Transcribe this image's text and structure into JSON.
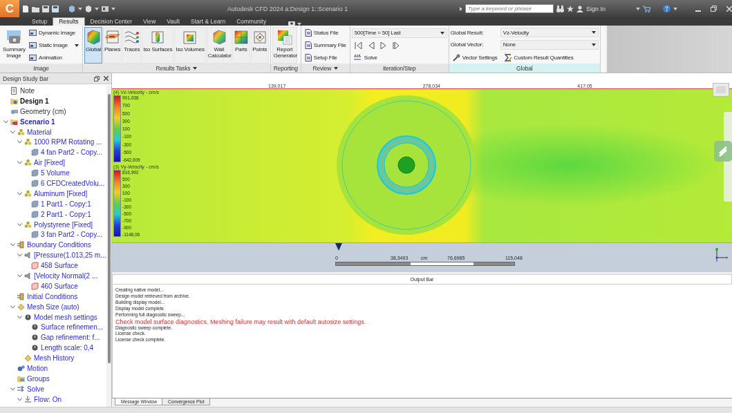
{
  "window": {
    "logo": "C",
    "title": "Autodesk CFD 2024   a:Design 1::Scenario 1"
  },
  "search": {
    "placeholder": "Type a keyword or phrase"
  },
  "account": {
    "sign_in": "Sign In"
  },
  "menu_tabs": [
    {
      "label": "Setup",
      "selected": false
    },
    {
      "label": "Results",
      "selected": true
    },
    {
      "label": "Decision Center",
      "selected": false
    },
    {
      "label": "View",
      "selected": false
    },
    {
      "label": "Vault",
      "selected": false
    },
    {
      "label": "Start & Learn",
      "selected": false
    },
    {
      "label": "Community",
      "selected": false
    }
  ],
  "ribbon": {
    "groups": [
      {
        "kind": "image",
        "label": "Image",
        "menu": false,
        "large": "Summary Image",
        "items": [
          {
            "label": "Dynamic Image",
            "dropdown": false
          },
          {
            "label": "Static Image",
            "dropdown": true
          },
          {
            "label": "Animation",
            "dropdown": false
          }
        ]
      },
      {
        "kind": "tasks",
        "label": "Results Tasks",
        "menu": true,
        "buttons": [
          {
            "label": "Global",
            "kind": "cube",
            "selected": true
          },
          {
            "label": "Planes",
            "kind": "plane",
            "selected": false
          },
          {
            "label": "Traces",
            "kind": "lines",
            "selected": false
          },
          {
            "label": "Iso Surfaces",
            "kind": "cylinder",
            "selected": false
          },
          {
            "label": "Iso Volumes",
            "kind": "volume",
            "selected": false
          },
          {
            "label": "Wall Calculator",
            "kind": "wall",
            "selected": false
          },
          {
            "label": "Parts",
            "kind": "parts",
            "selected": false
          },
          {
            "label": "Points",
            "kind": "point",
            "selected": false
          }
        ]
      },
      {
        "kind": "tasks",
        "label": "Reporting",
        "menu": false,
        "buttons": [
          {
            "label": "Report Generator",
            "kind": "report",
            "selected": false
          }
        ]
      },
      {
        "kind": "review",
        "label": "Review",
        "menu": true,
        "items": [
          "Status File",
          "Summary File",
          "Setup File"
        ]
      },
      {
        "kind": "iteration",
        "label": "Iteration/Step",
        "menu": false,
        "step": "500[Time = 50] Last",
        "solve": "Solve"
      },
      {
        "kind": "global",
        "label": "Global",
        "menu": false,
        "result_label": "Global Result:",
        "result": "Vz-Velocity",
        "vector_label": "Global Vector:",
        "vector": "None",
        "vector_settings": "Vector Settings",
        "custom_quantities": "Custom Result Quantities"
      }
    ]
  },
  "design_study_bar": {
    "title": "Design Study Bar",
    "tree": [
      {
        "label": "Note",
        "kind": "note"
      },
      {
        "label": "Design 1",
        "kind": "design"
      },
      {
        "label": "Geometry (cm)",
        "kind": "geometry"
      },
      {
        "label": "Scenario 1",
        "kind": "scenario",
        "expanded": true,
        "children": [
          {
            "label": "Material",
            "kind": "material",
            "expanded": true,
            "children": [
              {
                "label": "1000 RPM Rotating ...",
                "kind": "material",
                "expanded": true,
                "children": [
                  {
                    "label": "4 fan Part2 - Copy...",
                    "kind": "part"
                  }
                ]
              },
              {
                "label": "Air [Fixed]",
                "kind": "material",
                "expanded": true,
                "children": [
                  {
                    "label": "5 Volume",
                    "kind": "part"
                  },
                  {
                    "label": "6 CFDCreatedVolu...",
                    "kind": "part"
                  }
                ]
              },
              {
                "label": "Aluminum [Fixed]",
                "kind": "material",
                "expanded": true,
                "children": [
                  {
                    "label": "1 Part1 - Copy:1",
                    "kind": "part"
                  },
                  {
                    "label": "2 Part1 - Copy:1",
                    "kind": "part"
                  }
                ]
              },
              {
                "label": "Polystyrene [Fixed]",
                "kind": "material",
                "expanded": true,
                "children": [
                  {
                    "label": "3 fan Part2 - Copy...",
                    "kind": "part"
                  }
                ]
              }
            ]
          },
          {
            "label": "Boundary Conditions",
            "kind": "boundary",
            "expanded": true,
            "children": [
              {
                "label": "[Pressure(1.013,25 m...",
                "kind": "condition",
                "expanded": true,
                "children": [
                  {
                    "label": "458 Surface",
                    "kind": "surface"
                  }
                ]
              },
              {
                "label": "[Velocity Normal(2 ...",
                "kind": "condition",
                "expanded": true,
                "children": [
                  {
                    "label": "460 Surface",
                    "kind": "surface"
                  }
                ]
              }
            ]
          },
          {
            "label": "Initial Conditions",
            "kind": "boundary"
          },
          {
            "label": "Mesh Size (auto)",
            "kind": "mesh",
            "expanded": true,
            "children": [
              {
                "label": "Model mesh settings",
                "kind": "setting",
                "expanded": true,
                "children": [
                  {
                    "label": "Surface refinemen...",
                    "kind": "setting"
                  },
                  {
                    "label": "Gap refinement: f...",
                    "kind": "setting"
                  },
                  {
                    "label": "Length scale: 0,4",
                    "kind": "setting"
                  }
                ]
              },
              {
                "label": "Mesh History",
                "kind": "mesh"
              }
            ]
          },
          {
            "label": "Motion",
            "kind": "motion"
          },
          {
            "label": "Groups",
            "kind": "groups"
          },
          {
            "label": "Solve",
            "kind": "solve",
            "expanded": true,
            "children": [
              {
                "label": "Flow: On",
                "kind": "flow",
                "expanded": true
              }
            ]
          }
        ]
      }
    ]
  },
  "viewport": {
    "legends": [
      {
        "title": "(4) Vz-Velocity - cm/s",
        "max": "901,036",
        "ticks": [
          "700",
          "500",
          "300",
          "100",
          "-100",
          "-300",
          "-500"
        ],
        "min": "-642,009"
      },
      {
        "title": "(3) Vy-Velocity - cm/s",
        "max": "816,992",
        "ticks": [
          "500",
          "300",
          "100",
          "-100",
          "-300",
          "-500",
          "-700",
          "-900"
        ],
        "min": "-1148,06"
      }
    ],
    "ruler": [
      "139,017",
      "278,034",
      "417,05"
    ],
    "scale": {
      "labels": [
        "0",
        "38,3493",
        "76,6985",
        "115,048"
      ],
      "unit": "cm"
    }
  },
  "output_bar": {
    "title": "Output Bar",
    "messages": [
      {
        "text": "Creating native model...",
        "kind": "info"
      },
      {
        "text": "Design model retrieved from archive.",
        "kind": "info"
      },
      {
        "text": "Building display model...",
        "kind": "info"
      },
      {
        "text": "Display model complete.",
        "kind": "info"
      },
      {
        "text": "Performing full diagnostic sweep...",
        "kind": "info"
      },
      {
        "text": "Check model surface diagnostics. Meshing failure may result with default autosize settings.",
        "kind": "warning"
      },
      {
        "text": "Diagnostic sweep complete.",
        "kind": "info"
      },
      {
        "text": "License check.",
        "kind": "info"
      },
      {
        "text": "License check complete.",
        "kind": "info"
      }
    ],
    "tabs": [
      {
        "label": "Message Window",
        "selected": true
      },
      {
        "label": "Convergence Plot",
        "selected": false
      }
    ]
  }
}
